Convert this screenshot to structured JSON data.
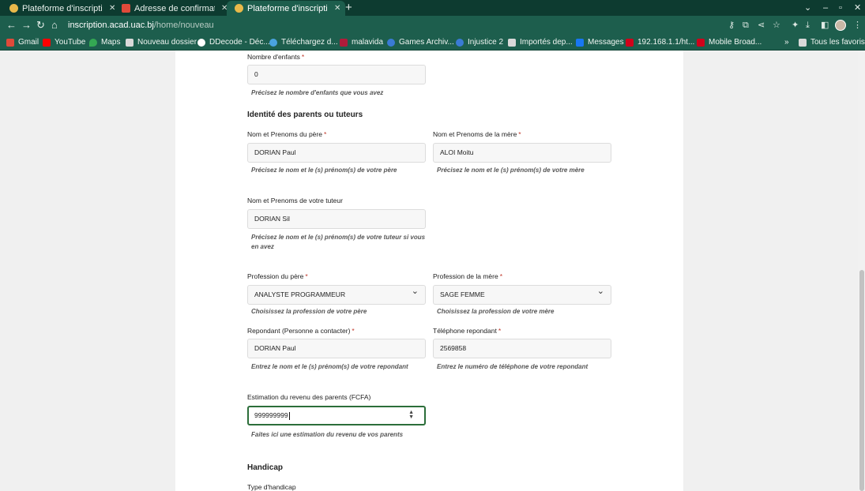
{
  "browser": {
    "tabs": [
      {
        "title": "Plateforme d'inscription",
        "favicon_color": "#e9b94a",
        "active": false
      },
      {
        "title": "Adresse de confirmation",
        "favicon_color": "#e04a3a",
        "active": false
      },
      {
        "title": "Plateforme d'inscription",
        "favicon_color": "#e9b94a",
        "active": true
      }
    ],
    "url_host": "inscription.acad.uac.bj",
    "url_path": "/home/nouveau",
    "bookmarks": [
      {
        "label": "Gmail",
        "color": "#e04a3a"
      },
      {
        "label": "YouTube",
        "color": "#ff0000"
      },
      {
        "label": "Maps",
        "color": "#34a853"
      },
      {
        "label": "Nouveau dossier",
        "color": "#d9d9d9"
      },
      {
        "label": "DDecode - Déc...",
        "color": "#ffffff"
      },
      {
        "label": "Téléchargez d...",
        "color": "#4aa3df"
      },
      {
        "label": "malavida",
        "color": "#b01b3a"
      },
      {
        "label": "Games Archiv...",
        "color": "#3a7bd5"
      },
      {
        "label": "Injustice 2",
        "color": "#3a7bd5"
      },
      {
        "label": "Importés dep...",
        "color": "#d9d9d9"
      },
      {
        "label": "Messages",
        "color": "#1877f2"
      },
      {
        "label": "192.168.1.1/ht...",
        "color": "#d0021b"
      },
      {
        "label": "Mobile Broad...",
        "color": "#d0021b"
      }
    ],
    "bookmarks_overflow": "»",
    "all_bookmarks": "Tous les favoris"
  },
  "form": {
    "children": {
      "label": "Nombre d'enfants",
      "required": "*",
      "value": "0",
      "hint": "Précisez le nombre d'enfants que vous avez"
    },
    "parents_section": "Identité des parents ou tuteurs",
    "father_name": {
      "label": "Nom et Prenoms du père",
      "required": "*",
      "value": "DORIAN Paul",
      "hint": "Précisez le nom et le (s) prénom(s) de votre père"
    },
    "mother_name": {
      "label": "Nom et Prenoms de la mère",
      "required": "*",
      "value": "ALOI Moitu",
      "hint": "Précisez le nom et le (s) prénom(s) de votre mère"
    },
    "tutor_name": {
      "label": "Nom et Prenoms de votre tuteur",
      "value": "DORIAN Sil",
      "hint": "Précisez le nom et le (s) prénom(s) de votre tuteur si vous en avez"
    },
    "father_profession": {
      "label": "Profession du père",
      "required": "*",
      "value": "ANALYSTE PROGRAMMEUR",
      "hint": "Choisissez la profession de votre père"
    },
    "mother_profession": {
      "label": "Profession de la mère",
      "required": "*",
      "value": "SAGE FEMME",
      "hint": "Choisissez la profession de votre mère"
    },
    "respondent": {
      "label": "Repondant (Personne a contacter)",
      "required": "*",
      "value": "DORIAN Paul",
      "hint": "Entrez le nom et le (s) prénom(s) de votre repondant"
    },
    "respondent_phone": {
      "label": "Téléphone repondant",
      "required": "*",
      "value": "2569858",
      "hint": "Entrez le numéro de téléphone de votre repondant"
    },
    "income": {
      "label": "Estimation du revenu des parents (FCFA)",
      "value": "999999999",
      "hint": "Faites ici une estimation du revenu de vos parents"
    },
    "handicap_section": "Handicap",
    "handicap_type": {
      "label": "Type d'handicap"
    }
  }
}
